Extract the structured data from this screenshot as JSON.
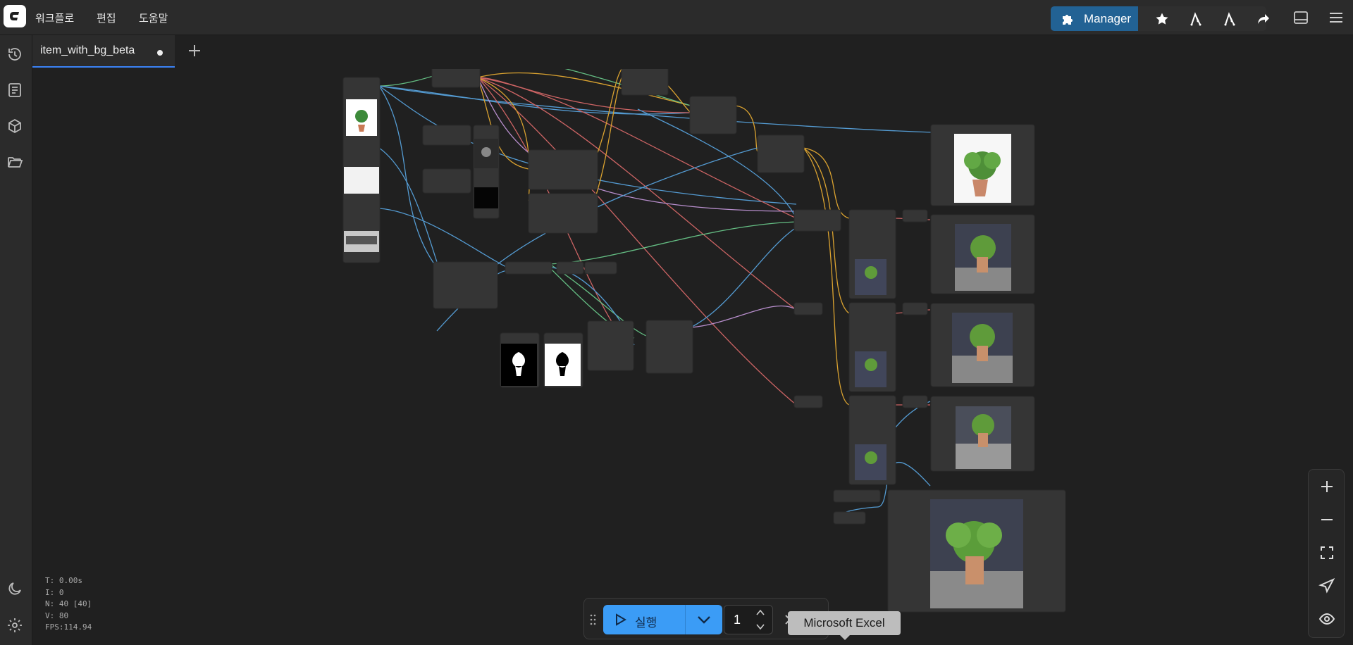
{
  "menu": {
    "workflow": "워크플로",
    "edit": "편집",
    "help": "도움말"
  },
  "toolbar": {
    "manager_label": "Manager"
  },
  "tab": {
    "title": "item_with_bg_beta"
  },
  "run": {
    "label": "실행",
    "quantity": "1"
  },
  "tooltip": {
    "text": "Microsoft Excel"
  },
  "stats": {
    "t": "T: 0.00s",
    "i": "I: 0",
    "n": "N: 40 [40]",
    "v": "V: 80",
    "fps": "FPS:114.94"
  },
  "icons": {
    "logo": "comfy-logo-icon",
    "history": "history-icon",
    "queue": "document-icon",
    "models": "cube-icon",
    "workflows": "folder-icon",
    "theme": "moon-icon",
    "settings": "gear-icon",
    "add_tab": "plus-icon",
    "zoom_in": "plus-icon",
    "zoom_out": "minus-icon",
    "fit": "fullscreen-icon",
    "locate": "send-icon",
    "visibility": "eye-icon"
  },
  "colors": {
    "accent": "#226294",
    "run": "#3b9cf6",
    "link_blue": "#5aa9e6",
    "link_orange": "#f0b232",
    "link_red": "#e06c6c",
    "link_green": "#6ccf8e"
  }
}
